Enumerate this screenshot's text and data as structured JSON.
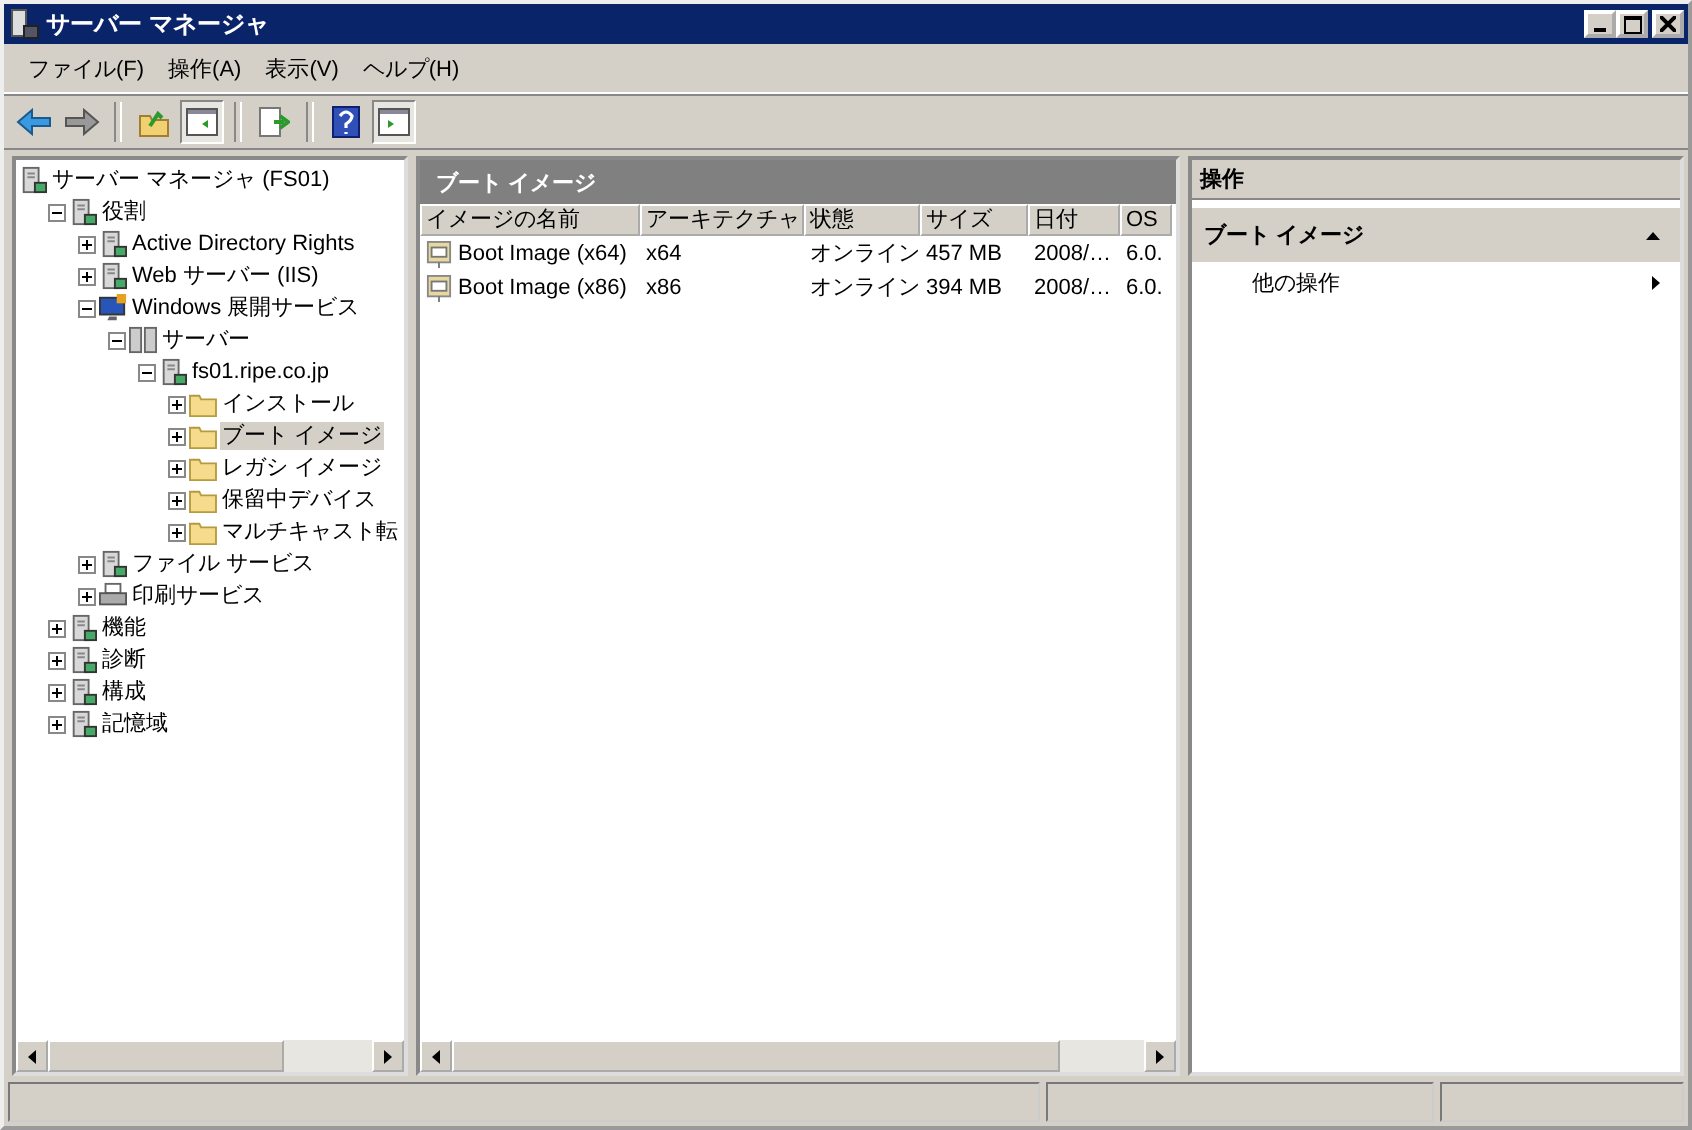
{
  "window": {
    "title": "サーバー マネージャ"
  },
  "menu": [
    "ファイル(F)",
    "操作(A)",
    "表示(V)",
    "ヘルプ(H)"
  ],
  "toolbar": [
    {
      "kind": "back",
      "pressed": false
    },
    {
      "kind": "forward",
      "pressed": false
    },
    {
      "kind": "sep"
    },
    {
      "kind": "up",
      "pressed": false
    },
    {
      "kind": "tree",
      "pressed": true
    },
    {
      "kind": "sep"
    },
    {
      "kind": "export",
      "pressed": false
    },
    {
      "kind": "sep"
    },
    {
      "kind": "help",
      "pressed": false
    },
    {
      "kind": "actionpane",
      "pressed": true
    }
  ],
  "tree": {
    "root": {
      "label": "サーバー マネージャ (FS01)",
      "kind": "server",
      "selected": false,
      "children": [
        {
          "label": "役割",
          "kind": "server",
          "expanded": true,
          "selected": false,
          "children": [
            {
              "label": "Active Directory Rights",
              "kind": "server",
              "expanded": false,
              "selected": false
            },
            {
              "label": "Web サーバー (IIS)",
              "kind": "server",
              "expanded": false,
              "selected": false
            },
            {
              "label": "Windows 展開サービス",
              "kind": "monitor",
              "expanded": true,
              "selected": false,
              "children": [
                {
                  "label": "サーバー",
                  "kind": "servers",
                  "expanded": true,
                  "selected": false,
                  "children": [
                    {
                      "label": "fs01.ripe.co.jp",
                      "kind": "server",
                      "expanded": true,
                      "selected": false,
                      "children": [
                        {
                          "label": "インストール",
                          "kind": "folder",
                          "expanded": false,
                          "selected": false
                        },
                        {
                          "label": "ブート イメージ",
                          "kind": "folder",
                          "expanded": false,
                          "selected": true
                        },
                        {
                          "label": "レガシ イメージ",
                          "kind": "folder",
                          "expanded": false,
                          "selected": false
                        },
                        {
                          "label": "保留中デバイス",
                          "kind": "folder",
                          "expanded": false,
                          "selected": false
                        },
                        {
                          "label": "マルチキャスト転",
                          "kind": "folder",
                          "expanded": false,
                          "selected": false
                        }
                      ]
                    }
                  ]
                }
              ]
            },
            {
              "label": "ファイル サービス",
              "kind": "server",
              "expanded": false,
              "selected": false
            },
            {
              "label": "印刷サービス",
              "kind": "printer",
              "expanded": false,
              "selected": false
            }
          ]
        },
        {
          "label": "機能",
          "kind": "server",
          "expanded": false,
          "selected": false
        },
        {
          "label": "診断",
          "kind": "server",
          "expanded": false,
          "selected": false
        },
        {
          "label": "構成",
          "kind": "server",
          "expanded": false,
          "selected": false
        },
        {
          "label": "記憶域",
          "kind": "server",
          "expanded": false,
          "selected": false
        }
      ]
    }
  },
  "list": {
    "title": "ブート イメージ",
    "columns": [
      "イメージの名前",
      "アーキテクチャ",
      "状態",
      "サイズ",
      "日付",
      "OS"
    ],
    "rows": [
      [
        "Boot Image (x64)",
        "x64",
        "オンライン",
        "457 MB",
        "2008/…",
        "6.0."
      ],
      [
        "Boot Image (x86)",
        "x86",
        "オンライン",
        "394 MB",
        "2008/…",
        "6.0."
      ]
    ]
  },
  "actions": {
    "title": "操作",
    "sections": [
      {
        "label": "ブート イメージ",
        "expanded": true,
        "items": [
          "他の操作"
        ]
      }
    ]
  }
}
